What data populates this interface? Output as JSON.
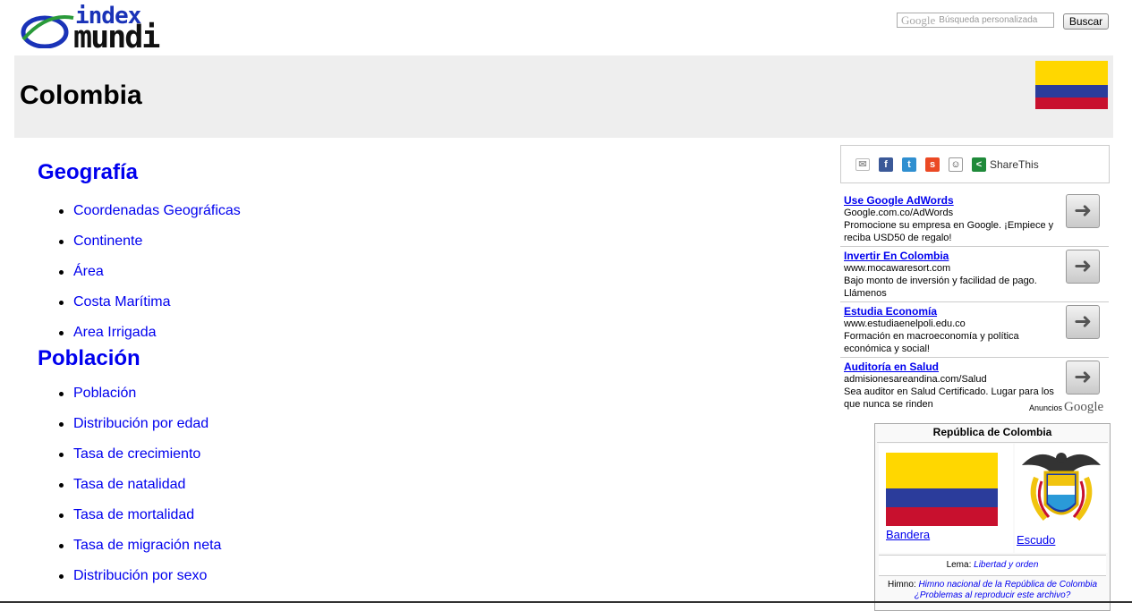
{
  "header": {
    "logo_top": "index",
    "logo_bottom": "mundi",
    "search_brand": "Google",
    "search_placeholder": "Búsqueda personalizada",
    "search_button": "Buscar"
  },
  "banner": {
    "country": "Colombia",
    "flag_colors": [
      "#ffd700",
      "#2b3c9b",
      "#c8102e"
    ]
  },
  "sections": [
    {
      "title": "Geografía",
      "items": [
        "Coordenadas Geográficas",
        "Continente",
        "Área",
        "Costa Marítima",
        "Area Irrigada"
      ]
    },
    {
      "title": "Población",
      "items": [
        "Población",
        "Distribución por edad",
        "Tasa de crecimiento",
        "Tasa de natalidad",
        "Tasa de mortalidad",
        "Tasa de migración neta",
        "Distribución por sexo"
      ]
    }
  ],
  "share": {
    "icons": [
      "email-icon",
      "facebook-icon",
      "twitter-icon",
      "stumbleupon-icon",
      "reddit-icon",
      "sharethis-icon"
    ],
    "label": "ShareThis"
  },
  "ads": [
    {
      "title": "Use Google AdWords",
      "url": "Google.com.co/AdWords",
      "desc": "Promocione su empresa en Google. ¡Empiece y reciba USD50 de regalo!"
    },
    {
      "title": "Invertir En Colombia",
      "url": "www.mocawaresort.com",
      "desc": "Bajo monto de inversión y facilidad de pago. Llámenos"
    },
    {
      "title": "Estudia Economía",
      "url": "www.estudiaenelpoli.edu.co",
      "desc": "Formación en macroeconomía y política económica y social!"
    },
    {
      "title": "Auditoría en Salud",
      "url": "admisionesareandina.com/Salud",
      "desc": "Sea auditor en Salud Certificado. Lugar para los que nunca se rinden"
    }
  ],
  "ads_footer": {
    "label": "Anuncios",
    "brand": "Google"
  },
  "infobox": {
    "title": "República de Colombia",
    "flag_label": "Bandera",
    "coat_label": "Escudo",
    "motto_label": "Lema:",
    "motto": "Libertad y orden",
    "anthem_label": "Himno:",
    "anthem": "Himno nacional de la República de Colombia",
    "anthem_help": "¿Problemas al reproducir este archivo?"
  }
}
